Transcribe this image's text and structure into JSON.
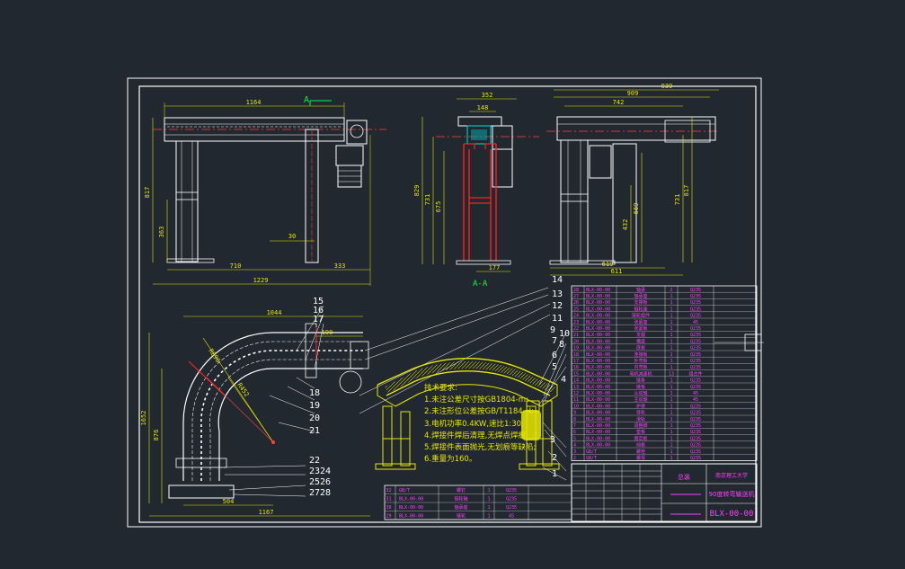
{
  "colors": {
    "background": "#212830",
    "frame": "#ffffff",
    "dimension": "#e8e800",
    "structure": "#ffffff",
    "red_member": "#ff2020",
    "centerline": "#ff4040",
    "magenta_text": "#ff40ff",
    "green_label": "#00ff40",
    "cyan": "#00e0e0"
  },
  "front_view": {
    "dims": {
      "top_width": "1164",
      "left_height": "817",
      "inner_height": "363",
      "bottom_left": "710",
      "bottom_right": "333",
      "total_width": "1229",
      "gap": "30"
    },
    "section_label": "A"
  },
  "side_view": {
    "dims": {
      "top_width": "352",
      "inner_width": "148",
      "height_total": "829",
      "height_a": "731",
      "height_b": "675",
      "bottom": "177"
    },
    "section_label": "A-A"
  },
  "right_view": {
    "dims": {
      "w1": "939",
      "w2": "909",
      "w3": "742",
      "h1": "817",
      "h2": "731",
      "h3": "669",
      "h4": "432",
      "b1": "619",
      "b2": "611"
    }
  },
  "plan_view": {
    "dims": {
      "top_width": "1044",
      "right_offset": "190",
      "height": "1652",
      "inner_height": "876",
      "r_outer": "R896",
      "r_inner": "R452",
      "bottom_inner": "504",
      "bottom_total": "1167"
    },
    "balloons_top": [
      "15",
      "16",
      "17"
    ],
    "balloons_mid": [
      "18",
      "19",
      "20",
      "21"
    ],
    "balloons_bottom": [
      "22",
      "2324",
      "2526",
      "2728"
    ]
  },
  "iso_view": {
    "balloons_left": [
      "14",
      "13",
      "12",
      "11",
      "9",
      "7",
      "6",
      "5",
      "4",
      "3",
      "2",
      "1"
    ],
    "balloons_right": [
      "10",
      "8"
    ]
  },
  "tech_notes": {
    "title": "技术要求:",
    "items": [
      "1.未注公差尺寸按GB1804-m;",
      "2.未注形位公差按GB/T1184-H;",
      "3.电机功率0.4KW,速比1:30;",
      "4.焊接件焊后清理,无焊点焊瘤;",
      "5.焊接件表面抛光,无划痕等缺陷;",
      "6.重量为160。"
    ]
  },
  "parts_list": [
    {
      "no": "28",
      "code": "BLX-00-00",
      "name": "轴承",
      "qty": "2",
      "mat": "Q235"
    },
    {
      "no": "27",
      "code": "BLX-00-00",
      "name": "轴承座",
      "qty": "1",
      "mat": "Q235"
    },
    {
      "no": "26",
      "code": "BLX-00-00",
      "name": "支撑板",
      "qty": "1",
      "mat": "Q235"
    },
    {
      "no": "25",
      "code": "BLX-00-00",
      "name": "链轮座",
      "qty": "1",
      "mat": "Q235"
    },
    {
      "no": "24",
      "code": "BLX-00-00",
      "name": "链轮组件",
      "qty": "1",
      "mat": "Q235"
    },
    {
      "no": "23",
      "code": "BLX-00-00",
      "name": "张紧座",
      "qty": "1",
      "mat": "45"
    },
    {
      "no": "22",
      "code": "BLX-00-00",
      "name": "张紧板",
      "qty": "1",
      "mat": "Q235"
    },
    {
      "no": "21",
      "code": "BLX-00-00",
      "name": "支腿",
      "qty": "1",
      "mat": "Q235"
    },
    {
      "no": "20",
      "code": "BLX-00-00",
      "name": "横梁",
      "qty": "1",
      "mat": "Q235"
    },
    {
      "no": "19",
      "code": "BLX-00-00",
      "name": "底板",
      "qty": "1",
      "mat": "Q235"
    },
    {
      "no": "18",
      "code": "BLX-00-00",
      "name": "连接板",
      "qty": "1",
      "mat": "Q235"
    },
    {
      "no": "17",
      "code": "BLX-00-00",
      "name": "外弯板",
      "qty": "1",
      "mat": "Q235"
    },
    {
      "no": "16",
      "code": "BLX-00-00",
      "name": "内弯板",
      "qty": "1",
      "mat": "Q235"
    },
    {
      "no": "15",
      "code": "BLX-00-00",
      "name": "电机减速机",
      "qty": "13",
      "mat": "组合件"
    },
    {
      "no": "14",
      "code": "BLX-00-00",
      "name": "链条",
      "qty": "1",
      "mat": "Q235"
    },
    {
      "no": "13",
      "code": "BLX-00-00",
      "name": "链板",
      "qty": "1",
      "mat": "Q235"
    },
    {
      "no": "12",
      "code": "BLX-00-00",
      "name": "从动轴",
      "qty": "1",
      "mat": "45"
    },
    {
      "no": "11",
      "code": "BLX-00-00",
      "name": "主动轴",
      "qty": "1",
      "mat": "45"
    },
    {
      "no": "10",
      "code": "BLX-00-00",
      "name": "护罩",
      "qty": "1",
      "mat": "Q235"
    },
    {
      "no": "9",
      "code": "BLX-00-00",
      "name": "导轨",
      "qty": "1",
      "mat": "Q235"
    },
    {
      "no": "8",
      "code": "BLX-00-00",
      "name": "滑轨",
      "qty": "1",
      "mat": "Q235"
    },
    {
      "no": "7",
      "code": "BLX-00-00",
      "name": "调整脚",
      "qty": "1",
      "mat": "Q235"
    },
    {
      "no": "6",
      "code": "BLX-00-00",
      "name": "垫板",
      "qty": "1",
      "mat": "Q235"
    },
    {
      "no": "5",
      "code": "BLX-00-00",
      "name": "固定板",
      "qty": "1",
      "mat": "Q235"
    },
    {
      "no": "4",
      "code": "BLX-00-00",
      "name": "挡板",
      "qty": "1",
      "mat": "Q235"
    },
    {
      "no": "3",
      "code": "GB/T",
      "name": "螺栓",
      "qty": "1",
      "mat": "Q235"
    },
    {
      "no": "2",
      "code": "GB/T",
      "name": "螺母",
      "qty": "1",
      "mat": "Q235"
    }
  ],
  "parts_list_lower": [
    {
      "no": "32",
      "code": "GB/T",
      "name": "螺钉",
      "qty": "1",
      "mat": "Q235"
    },
    {
      "no": "31",
      "code": "BLX-00-00",
      "name": "链轮轴",
      "qty": "1",
      "mat": "Q235"
    },
    {
      "no": "30",
      "code": "BLX-00-00",
      "name": "轴承座",
      "qty": "1",
      "mat": "Q235"
    },
    {
      "no": "29",
      "code": "BLX-00-00",
      "name": "链轮",
      "qty": "1",
      "mat": "45"
    }
  ],
  "title_block": {
    "school": "南京理工大学",
    "drawing_title": "90度转弯输送机",
    "drawing_code": "BLX-00-00",
    "stage": "总装"
  }
}
